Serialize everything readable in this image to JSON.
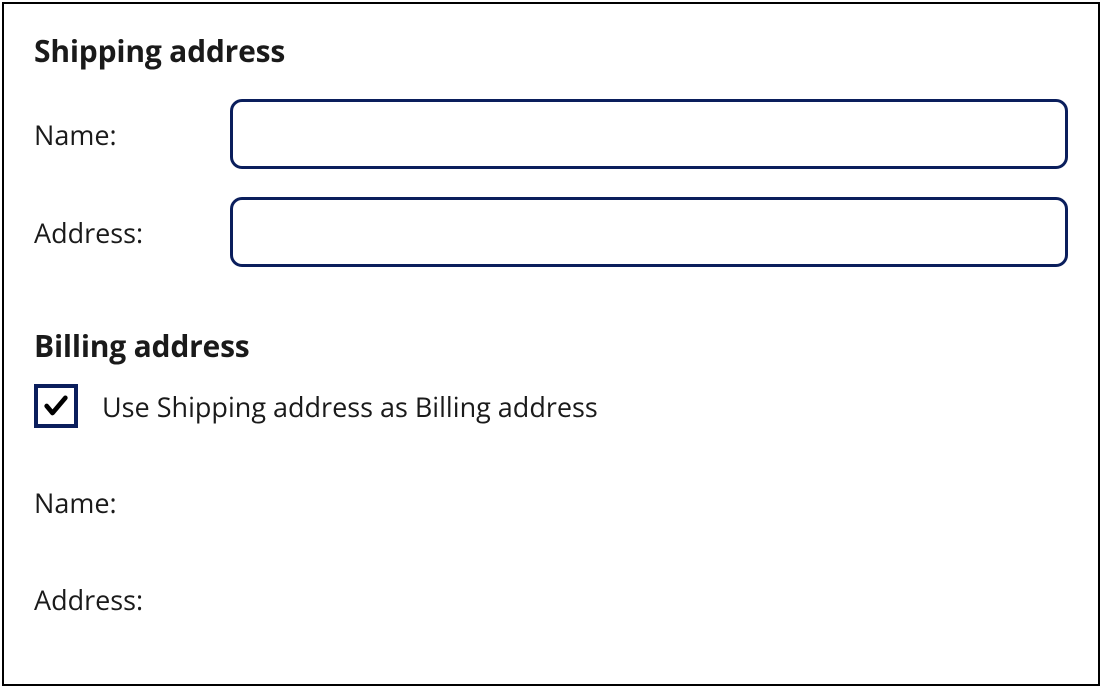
{
  "shipping": {
    "heading": "Shipping address",
    "name_label": "Name:",
    "name_value": "",
    "address_label": "Address:",
    "address_value": ""
  },
  "billing": {
    "heading": "Billing address",
    "use_shipping_label": "Use Shipping address as Billing address",
    "use_shipping_checked": true,
    "name_label": "Name:",
    "address_label": "Address:"
  }
}
